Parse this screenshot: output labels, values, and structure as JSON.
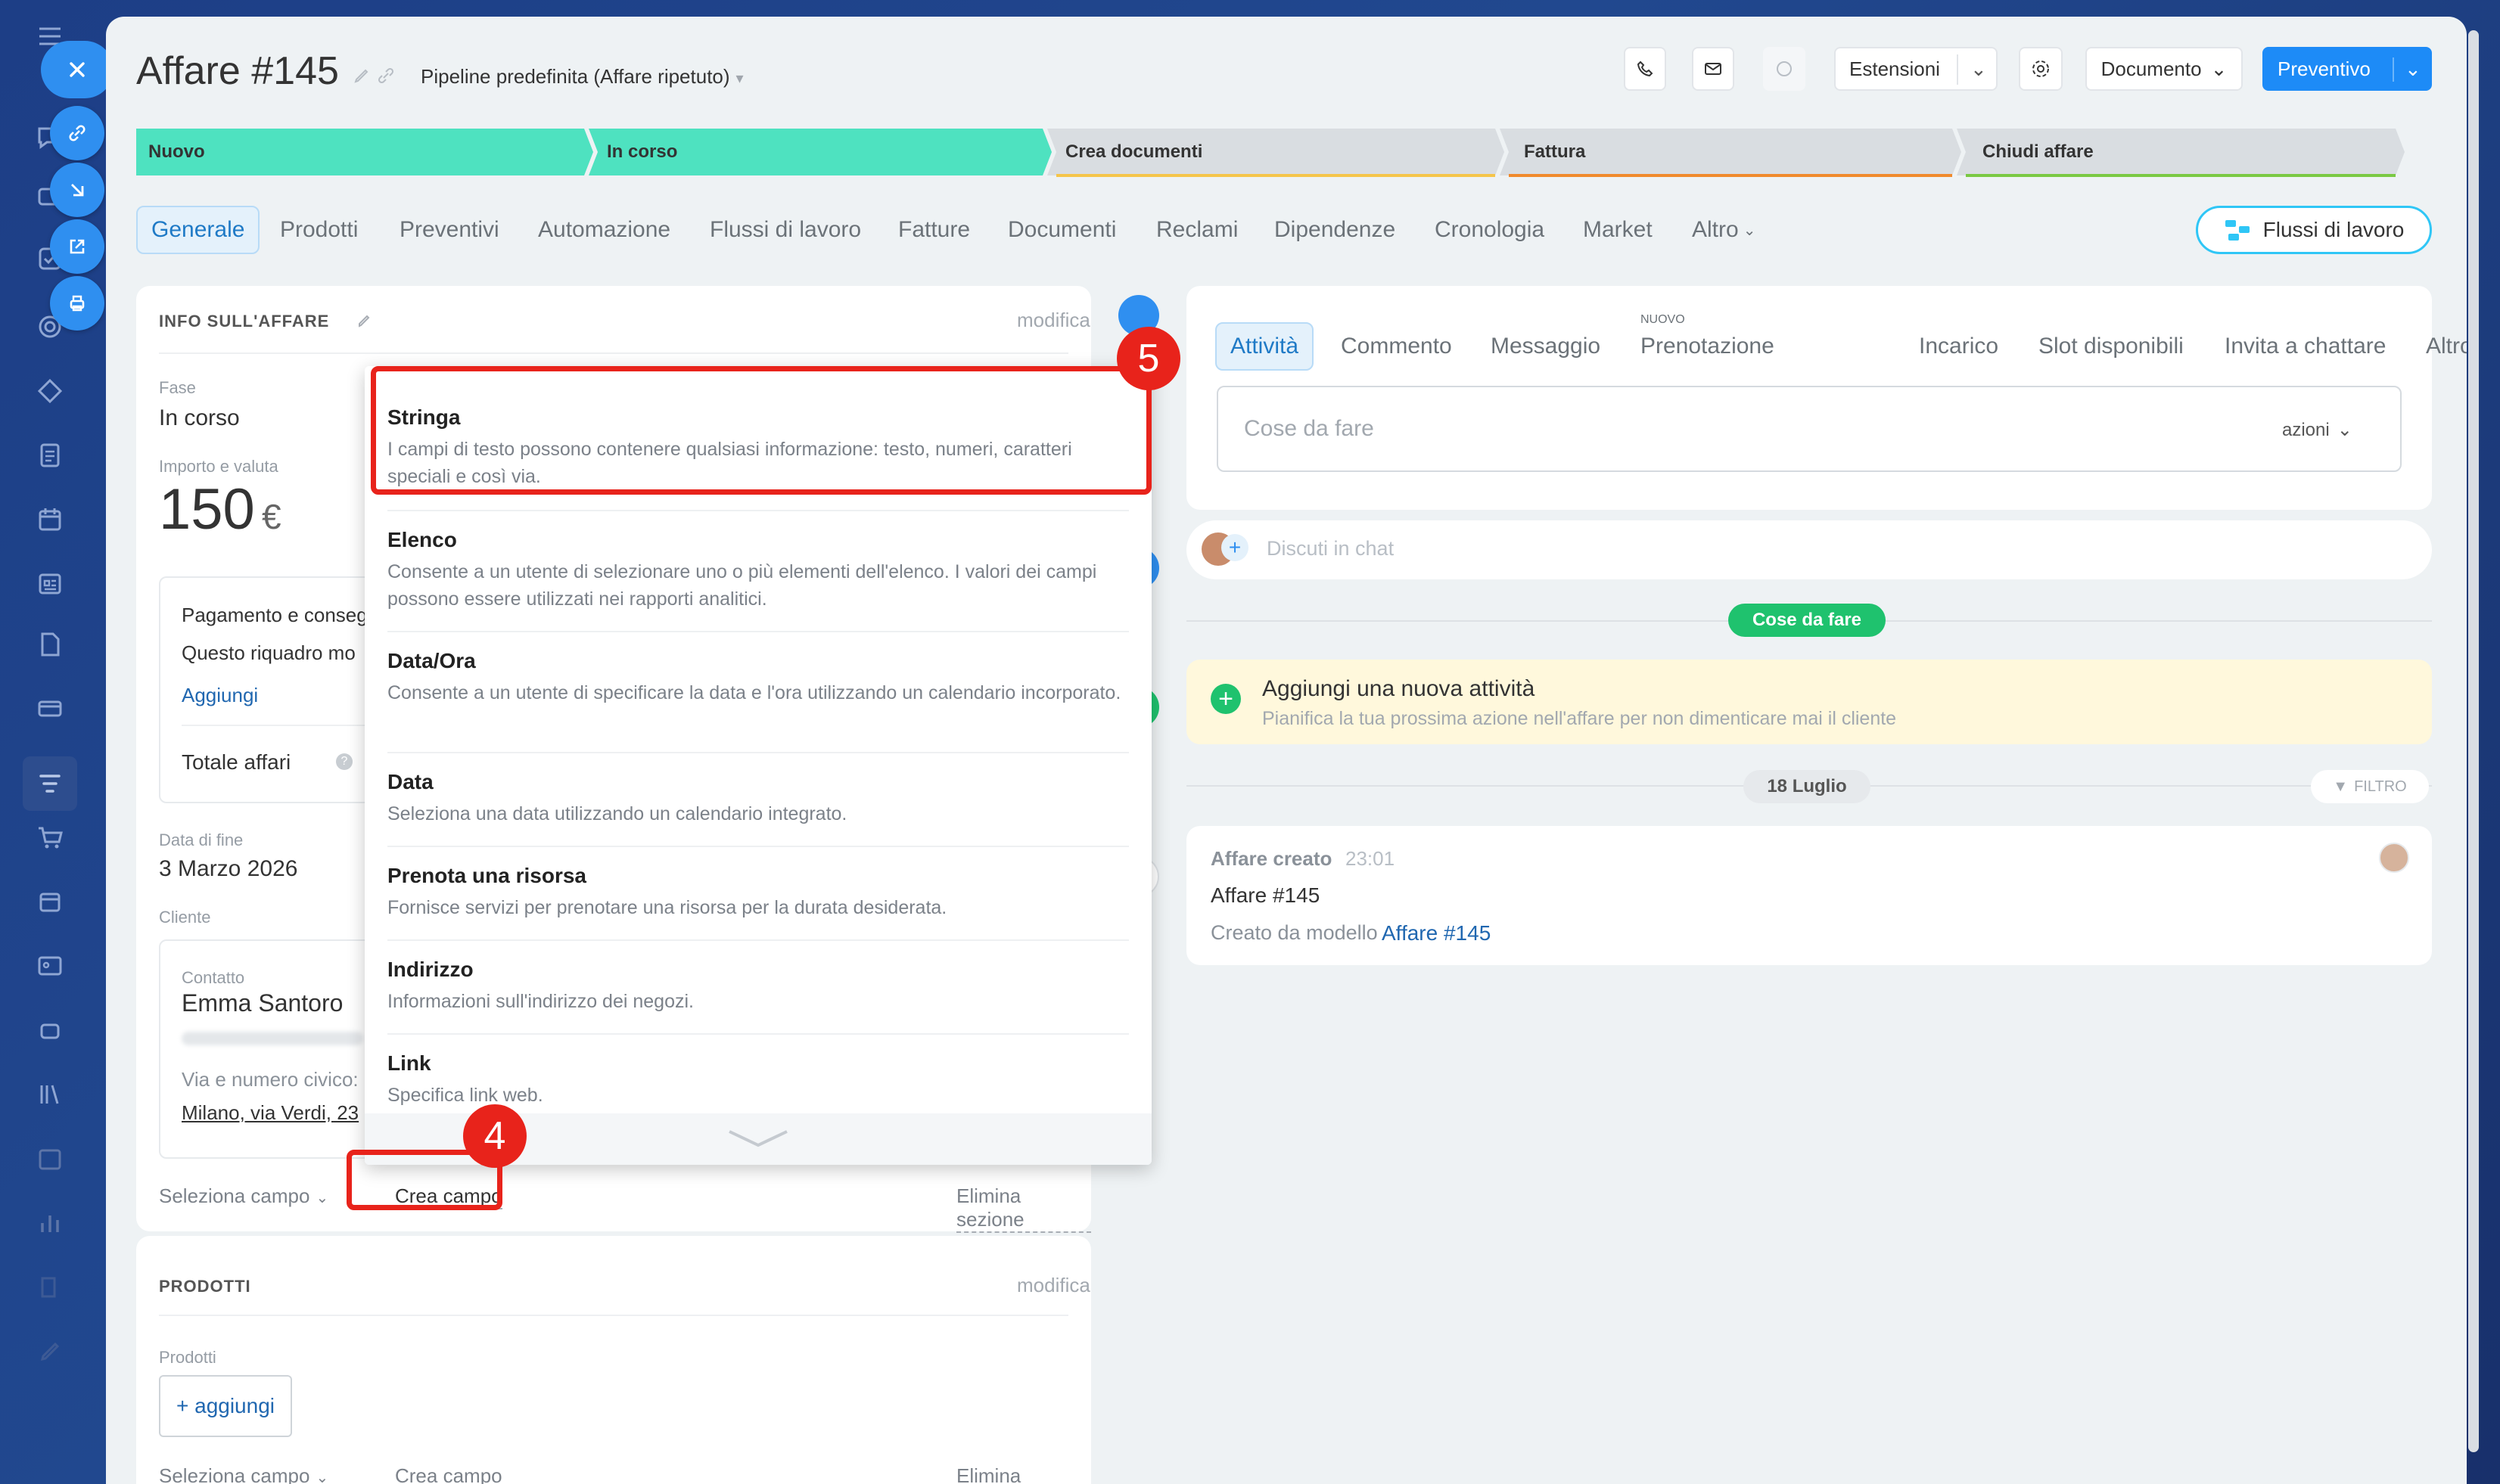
{
  "deal": {
    "title": "Affare #145",
    "pipeline": "Pipeline predefinita (Affare ripetuto)",
    "header_buttons": {
      "extensions": "Estensioni",
      "document": "Documento",
      "quote": "Preventivo"
    }
  },
  "stages": [
    {
      "label": "Nuovo",
      "status": "done"
    },
    {
      "label": "In corso",
      "status": "current"
    },
    {
      "label": "Crea documenti",
      "status": "todo"
    },
    {
      "label": "Fattura",
      "status": "todo"
    },
    {
      "label": "Chiudi affare",
      "status": "todo"
    }
  ],
  "stage_colors": {
    "done": "#4ee2c0",
    "todo": "#d9dde1",
    "underline_3": "#f5c54a",
    "underline_4": "#f08a2c",
    "underline_5": "#7ac943"
  },
  "tabs": [
    "Generale",
    "Prodotti",
    "Preventivi",
    "Automazione",
    "Flussi di lavoro",
    "Fatture",
    "Documenti",
    "Reclami",
    "Dipendenze",
    "Cronologia",
    "Market",
    "Altro"
  ],
  "workflow_button": "Flussi di lavoro",
  "info_section": {
    "title": "INFO SULL'AFFARE",
    "edit": "modifica",
    "stage_label": "Fase",
    "stage_value": "In corso",
    "amount_label": "Importo e valuta",
    "amount_value": "150",
    "currency": "€",
    "payment_title": "Pagamento e consegn",
    "payment_desc": "Questo riquadro mo",
    "add_link": "Aggiungi",
    "total_deals": "Totale affari",
    "end_date_label": "Data di fine",
    "end_date_value": "3 Marzo 2026",
    "client_label": "Cliente",
    "contact_label": "Contatto",
    "contact_name": "Emma Santoro",
    "address_label": "Via e numero civico:",
    "address_value": "Milano, via Verdi, 23",
    "select_field": "Seleziona campo",
    "create_field": "Crea campo",
    "delete_section": "Elimina sezione"
  },
  "products_section": {
    "title": "PRODOTTI",
    "edit": "modifica",
    "products_label": "Prodotti",
    "add": "+ aggiungi",
    "select_field": "Seleziona campo",
    "create_field": "Crea campo",
    "delete_section": "Elimina sezione"
  },
  "field_types": [
    {
      "name": "Stringa",
      "description": "I campi di testo possono contenere qualsiasi informazione: testo, numeri, caratteri speciali e così via."
    },
    {
      "name": "Elenco",
      "description": "Consente a un utente di selezionare uno o più elementi dell'elenco. I valori dei campi possono essere utilizzati nei rapporti analitici."
    },
    {
      "name": "Data/Ora",
      "description": "Consente a un utente di specificare la data e l'ora utilizzando un calendario incorporato."
    },
    {
      "name": "Data",
      "description": "Seleziona una data utilizzando un calendario integrato."
    },
    {
      "name": "Prenota una risorsa",
      "description": "Fornisce servizi per prenotare una risorsa per la durata desiderata."
    },
    {
      "name": "Indirizzo",
      "description": "Informazioni sull'indirizzo dei negozi."
    },
    {
      "name": "Link",
      "description": "Specifica link web."
    }
  ],
  "annotations": {
    "step_create_field": "4",
    "step_string": "5"
  },
  "timeline": {
    "tabs": [
      "Attività",
      "Commento",
      "Messaggio",
      "Prenotazione",
      "Incarico",
      "Slot disponibili",
      "Invita a chattare",
      "Altro"
    ],
    "new_badge": "NUOVO",
    "todo_placeholder": "Cose da fare",
    "actions": "azioni",
    "chat_placeholder": "Discuti in chat",
    "todo_pill": "Cose da fare",
    "add_activity_title": "Aggiungi una nuova attività",
    "add_activity_desc": "Pianifica la tua prossima azione nell'affare per non dimenticare mai il cliente",
    "date_pill": "18 Luglio",
    "filter": "FILTRO",
    "event_title": "Affare creato",
    "event_time": "23:01",
    "event_deal": "Affare #145",
    "event_created_from": "Creato da modello",
    "event_link": "Affare #145"
  },
  "colors": {
    "accent": "#1d8bf7",
    "red": "#e8231b",
    "green": "#1fc26e",
    "yellow_bg": "#fff8dc"
  }
}
